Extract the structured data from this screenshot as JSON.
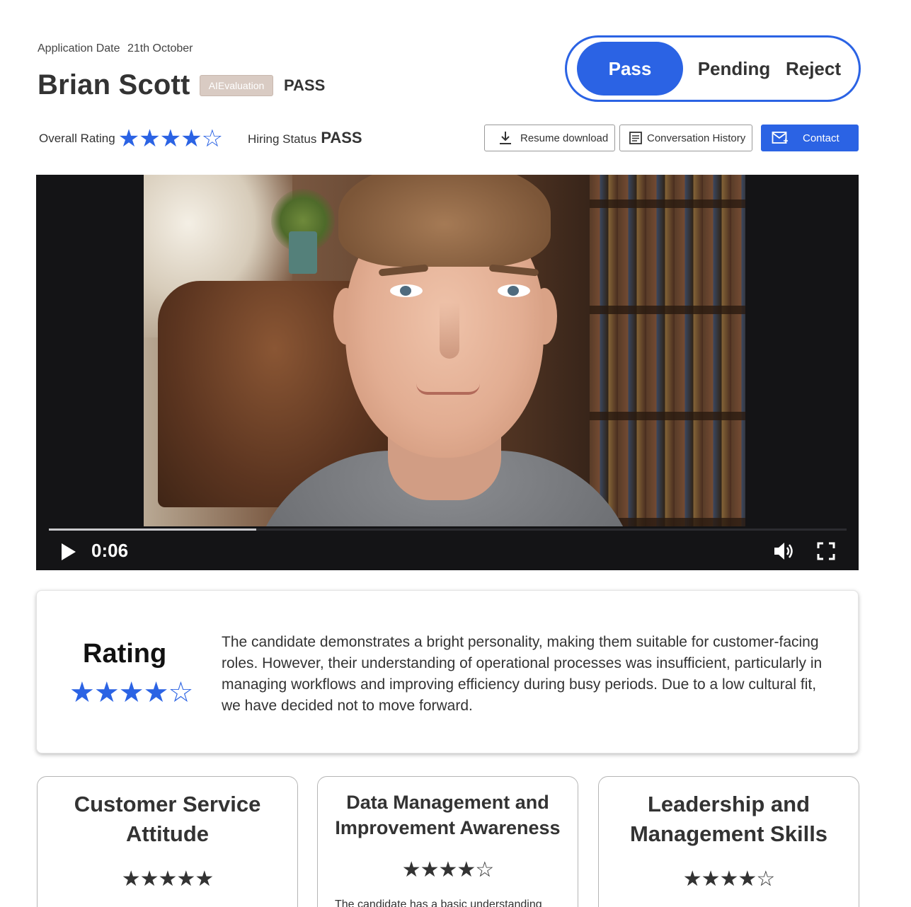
{
  "header": {
    "application_date_label": "Application Date",
    "application_date_value": "21th October",
    "candidate_name": "Brian Scott",
    "ai_badge": "AIEvaluation",
    "ai_result": "PASS"
  },
  "decision_toggle": {
    "options": [
      "Pass",
      "Pending",
      "Reject"
    ],
    "selected": "Pass"
  },
  "overall_rating": {
    "label": "Overall Rating",
    "stars": "★★★★☆",
    "value": 4,
    "max": 5
  },
  "hiring_status": {
    "label": "Hiring Status",
    "value": "PASS"
  },
  "actions": {
    "resume_label": "Resume download",
    "history_label": "Conversation History",
    "contact_label": "Contact"
  },
  "video": {
    "time": "0:06",
    "progress": 0.26
  },
  "summary": {
    "title": "Rating",
    "stars": "★★★★☆",
    "value": 4,
    "text": "The candidate demonstrates a bright personality, making them suitable for customer-facing roles. However, their understanding of operational processes was insufficient, particularly in managing workflows and improving efficiency during busy periods. Due to a low cultural fit, we have decided not to move forward."
  },
  "skills": [
    {
      "title": "Customer Service Attitude",
      "stars": "★★★★★",
      "value": 5
    },
    {
      "title": "Data Management and Improvement Awareness",
      "stars": "★★★★☆",
      "value": 4,
      "description": "The candidate has a basic understanding"
    },
    {
      "title": "Leadership and Management Skills",
      "stars": "★★★★☆",
      "value": 4
    }
  ],
  "colors": {
    "accent": "#2b63e4",
    "badge": "#d9cbc3",
    "video_bg": "#141416"
  }
}
